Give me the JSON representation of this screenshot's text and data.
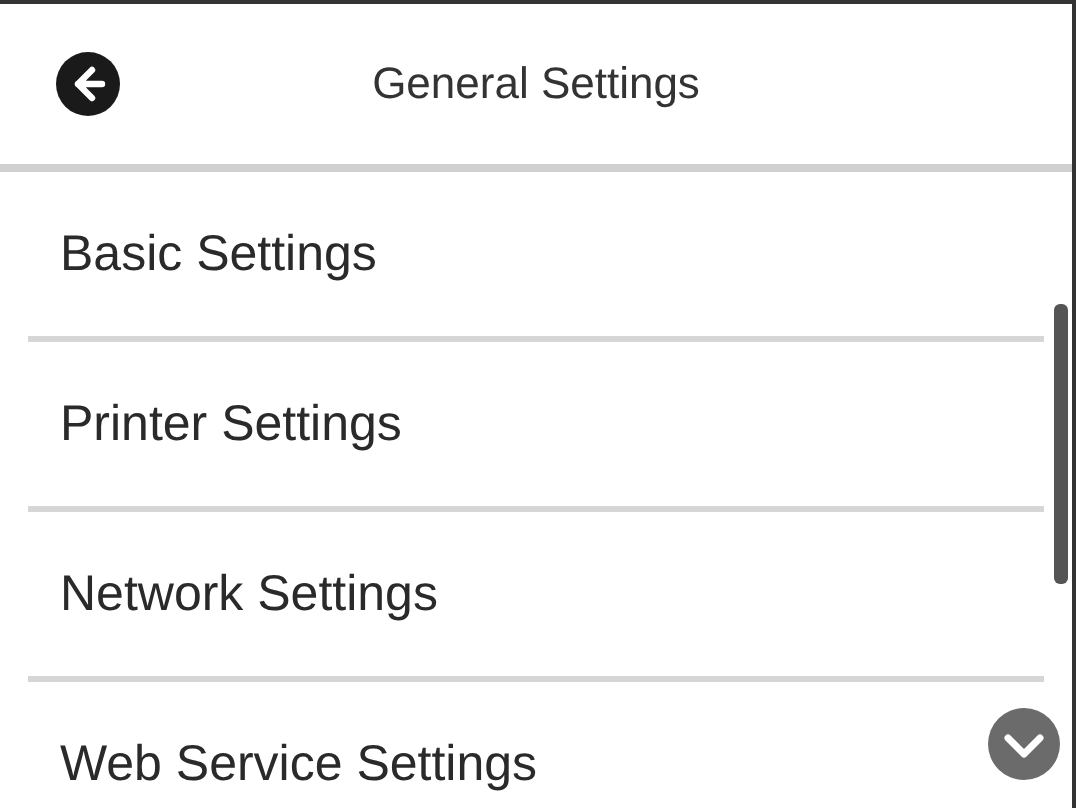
{
  "header": {
    "title": "General Settings"
  },
  "menu_items": [
    {
      "label": "Basic Settings"
    },
    {
      "label": "Printer Settings"
    },
    {
      "label": "Network Settings"
    },
    {
      "label": "Web Service Settings"
    }
  ]
}
